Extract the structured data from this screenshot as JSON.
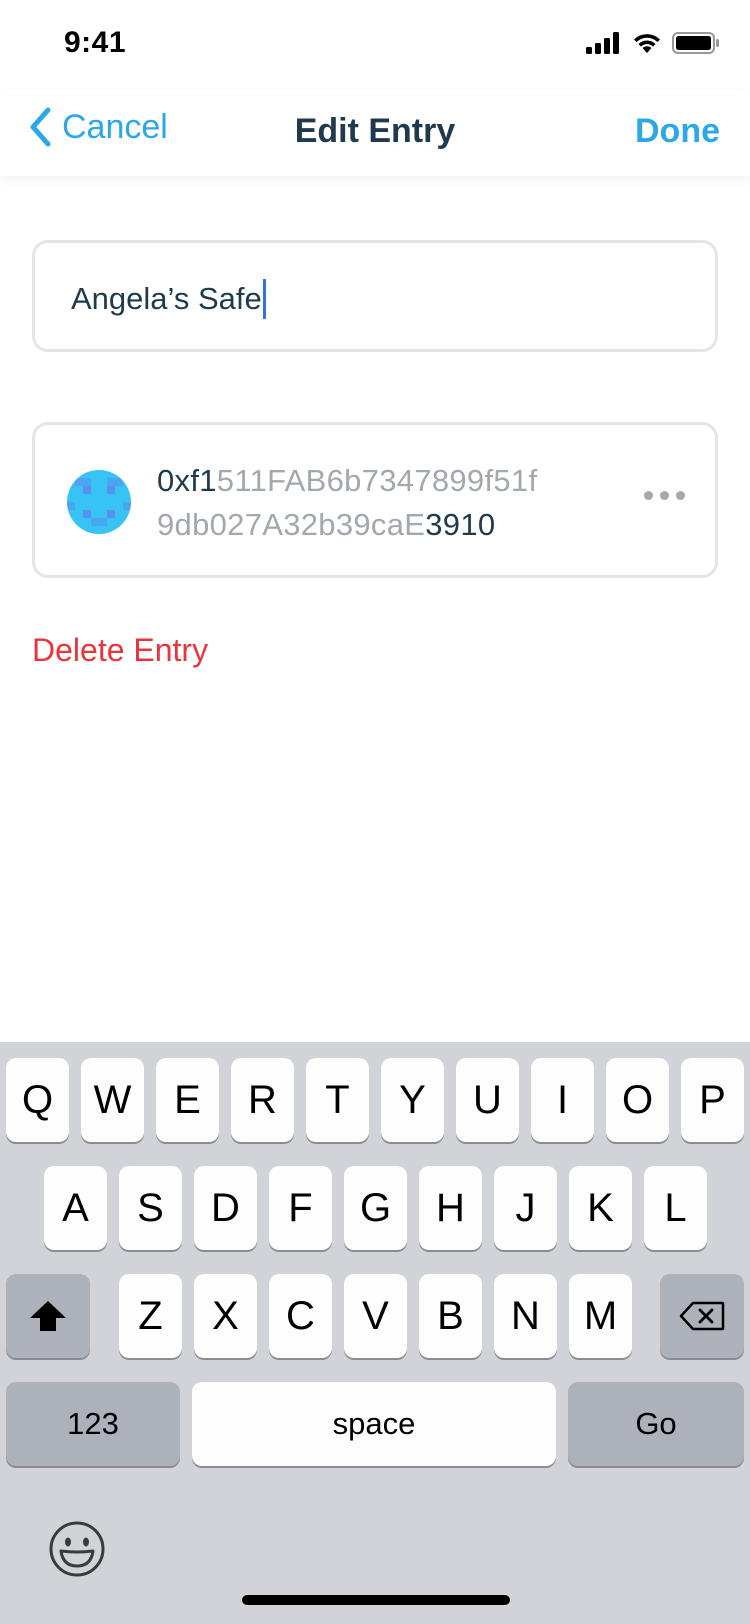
{
  "status_bar": {
    "time": "9:41"
  },
  "nav": {
    "cancel_label": "Cancel",
    "title": "Edit Entry",
    "done_label": "Done"
  },
  "entry": {
    "name_value": "Angela’s Safe",
    "address_line1_strong": "0xf1",
    "address_line1_muted": "511FAB6b7347899f51f",
    "address_line2_muted": "9db027A32b39caE",
    "address_line2_strong": "3910"
  },
  "actions": {
    "delete_label": "Delete Entry"
  },
  "keyboard": {
    "row1": [
      "Q",
      "W",
      "E",
      "R",
      "T",
      "Y",
      "U",
      "I",
      "O",
      "P"
    ],
    "row2": [
      "A",
      "S",
      "D",
      "F",
      "G",
      "H",
      "J",
      "K",
      "L"
    ],
    "row3": [
      "Z",
      "X",
      "C",
      "V",
      "B",
      "N",
      "M"
    ],
    "numbers_label": "123",
    "space_label": "space",
    "go_label": "Go"
  },
  "colors": {
    "accent": "#2ba8e8",
    "text_primary": "#1f3a4d",
    "text_muted": "#a2a8af",
    "danger": "#e8343a",
    "identicon": "#37c4f5"
  },
  "icons": [
    "chevron-left-icon",
    "signal-icon",
    "wifi-icon",
    "battery-icon",
    "identicon",
    "more-icon",
    "shift-icon",
    "backspace-icon",
    "emoji-icon"
  ]
}
